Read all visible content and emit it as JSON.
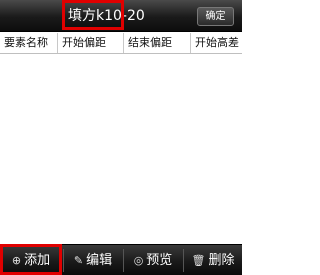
{
  "titlebar": {
    "title": "填方k10-20",
    "confirm_label": "确定"
  },
  "table": {
    "columns": [
      "要素名称",
      "开始偏距",
      "结束偏距",
      "开始高差"
    ]
  },
  "toolbar": {
    "add_label": "添加",
    "edit_label": "编辑",
    "preview_label": "预览",
    "delete_label": "删除",
    "add_icon": "plus-circle-icon",
    "edit_icon": "pencil-icon",
    "preview_icon": "eye-icon",
    "delete_icon": "trash-icon"
  },
  "highlights": {
    "color": "#e00000"
  }
}
